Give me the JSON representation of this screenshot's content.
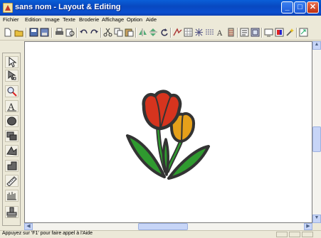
{
  "window": {
    "title": "sans nom - Layout & Editing"
  },
  "menu": [
    "Fichier",
    "Edition",
    "Image",
    "Texte",
    "Broderie",
    "Affichage",
    "Option",
    "Aide"
  ],
  "toolbar_icons": [
    "new-icon",
    "open-icon",
    "save-icon",
    "save-as-icon",
    "print-icon",
    "print-preview-icon",
    "undo-icon",
    "redo-icon",
    "cut-icon",
    "copy-icon",
    "paste-icon",
    "mirror-icon",
    "flip-icon",
    "rotate-icon",
    "sew-order-icon",
    "grid-icon",
    "pattern-icon",
    "stitch-icon",
    "font-icon",
    "thread-icon",
    "property-icon",
    "design-page-icon",
    "preview-icon",
    "color-icon",
    "wizard-icon",
    "export-icon"
  ],
  "left_tools": [
    "select-icon",
    "point-edit-icon",
    "zoom-icon",
    "text-icon",
    "circle-icon",
    "rectangle-icon",
    "outline-icon",
    "shape-icon",
    "ruler-icon",
    "manual-punch-icon",
    "stamp-icon"
  ],
  "status": {
    "text": "Appuyez sur 'F1' pour faire appel à l'Aide"
  },
  "colors": {
    "title_bar": "#0a4fd0",
    "tulip_red": "#d6341e",
    "tulip_yellow": "#e6a01a",
    "leaf_green": "#2f9a2f",
    "outline": "#333333"
  }
}
